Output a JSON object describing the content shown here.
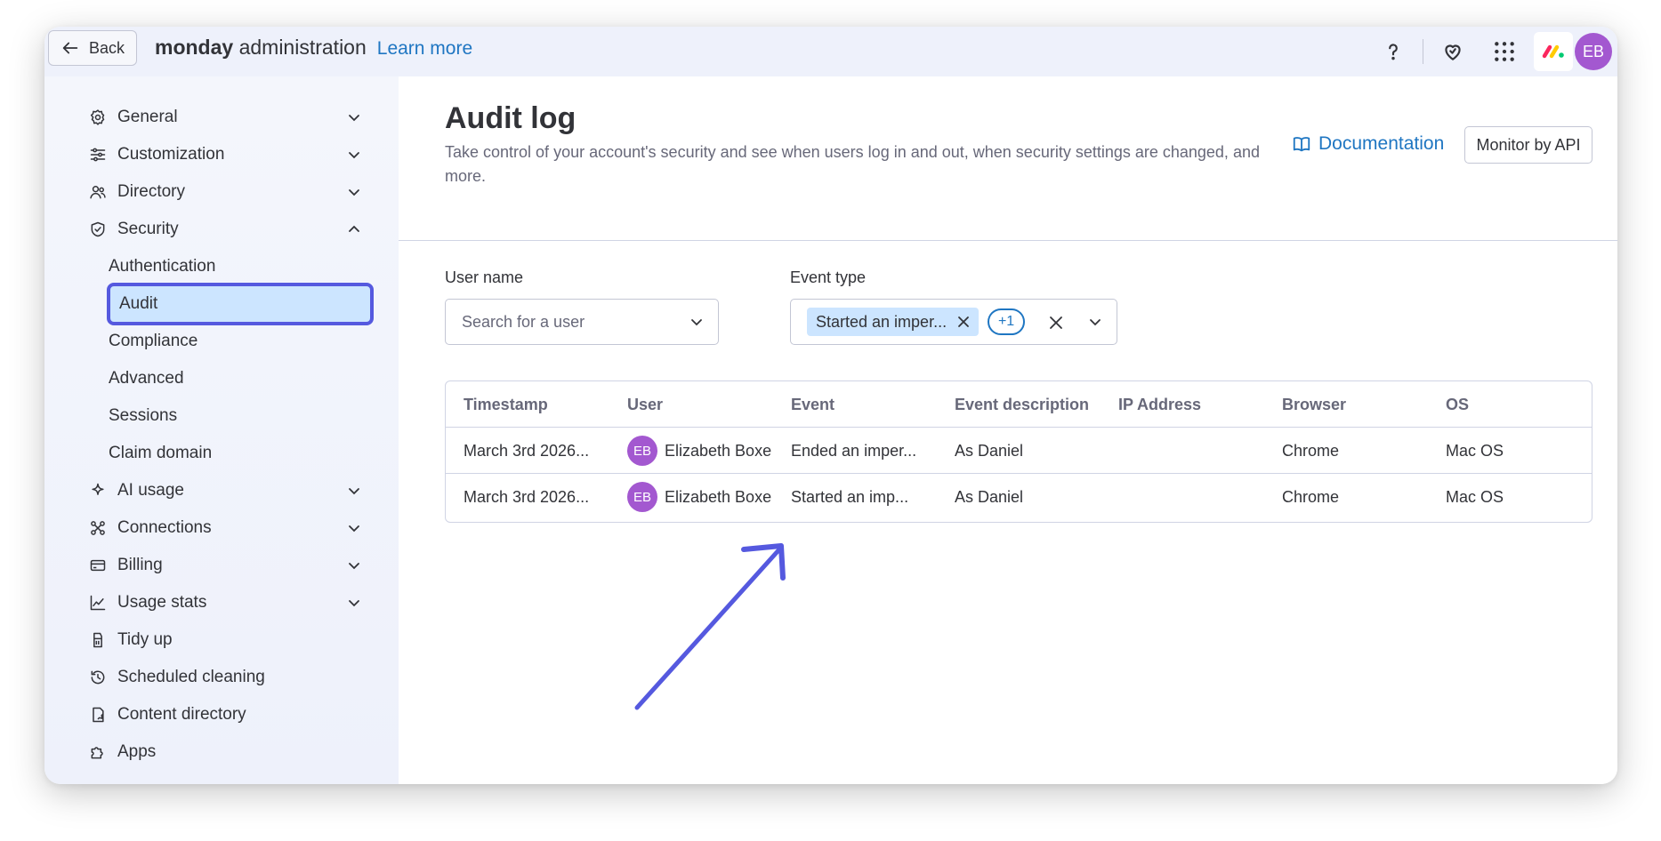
{
  "topbar": {
    "back_label": "Back",
    "brand_bold": "monday",
    "brand_rest": "administration",
    "learn_more": "Learn more",
    "avatar_initials": "EB"
  },
  "sidebar": {
    "items": [
      {
        "label": "General",
        "icon": "gear-icon",
        "expandable": "down"
      },
      {
        "label": "Customization",
        "icon": "sliders-icon",
        "expandable": "down"
      },
      {
        "label": "Directory",
        "icon": "users-icon",
        "expandable": "down"
      },
      {
        "label": "Security",
        "icon": "shield-icon",
        "expandable": "up"
      },
      {
        "label": "AI usage",
        "icon": "sparkle-icon",
        "expandable": "down"
      },
      {
        "label": "Connections",
        "icon": "connections-icon",
        "expandable": "down"
      },
      {
        "label": "Billing",
        "icon": "credit-card-icon",
        "expandable": "down"
      },
      {
        "label": "Usage stats",
        "icon": "chart-line-icon",
        "expandable": "down"
      },
      {
        "label": "Tidy up",
        "icon": "broom-icon"
      },
      {
        "label": "Scheduled cleaning",
        "icon": "clock-history-icon"
      },
      {
        "label": "Content directory",
        "icon": "content-icon"
      },
      {
        "label": "Apps",
        "icon": "puzzle-icon"
      }
    ],
    "security_subitems": [
      "Authentication",
      "Audit",
      "Compliance",
      "Advanced",
      "Sessions",
      "Claim domain"
    ]
  },
  "main": {
    "title": "Audit log",
    "description": "Take control of your account's security and see when users log in and out, when security settings are changed, and more.",
    "documentation": "Documentation",
    "monitor_api": "Monitor by API"
  },
  "filters": {
    "user_label": "User name",
    "user_placeholder": "Search for a user",
    "event_label": "Event type",
    "event_chip": "Started an imper...",
    "event_more": "+1"
  },
  "table": {
    "headers": [
      "Timestamp",
      "User",
      "Event",
      "Event description",
      "IP Address",
      "Browser",
      "OS"
    ],
    "rows": [
      {
        "timestamp": "March 3rd 2026...",
        "initials": "EB",
        "user": "Elizabeth Boxe",
        "event": "Ended an imper...",
        "description": "As Daniel",
        "ip": "",
        "browser": "Chrome",
        "os": "Mac OS"
      },
      {
        "timestamp": "March 3rd 2026...",
        "initials": "EB",
        "user": "Elizabeth Boxe",
        "event": "Started an imp...",
        "description": "As Daniel",
        "ip": "",
        "browser": "Chrome",
        "os": "Mac OS"
      }
    ]
  },
  "colors": {
    "accent": "#5559df",
    "link": "#1f76c2",
    "avatar": "#a358d0",
    "selected_bg": "#cce5ff"
  }
}
